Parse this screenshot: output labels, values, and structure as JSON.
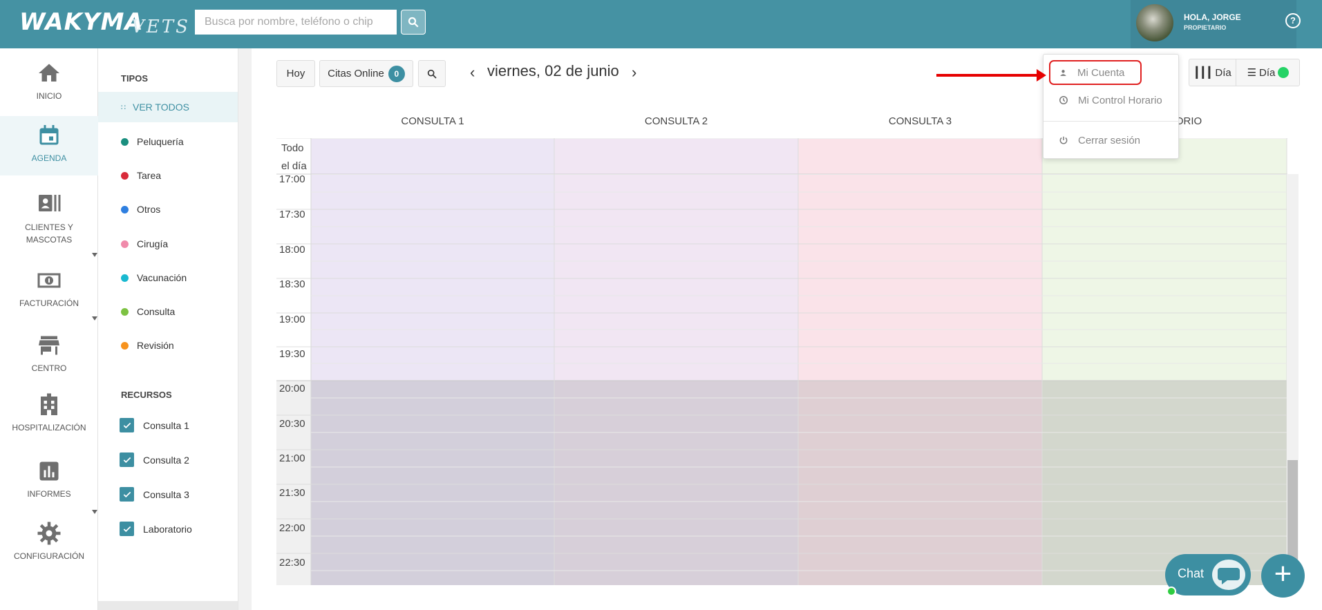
{
  "header": {
    "logo": "WAKYMA",
    "logo_sub": "VETS",
    "search_placeholder": "Busca por nombre, teléfono o chip",
    "greeting": "HOLA, JORGE",
    "role": "PROPIETARIO",
    "help": "?"
  },
  "nav": {
    "items": [
      {
        "label": "INICIO",
        "icon": "home-icon"
      },
      {
        "label": "AGENDA",
        "icon": "calendar-icon"
      },
      {
        "label": "CLIENTES Y MASCOTAS",
        "icon": "contacts-icon"
      },
      {
        "label": "FACTURACIÓN",
        "icon": "money-icon"
      },
      {
        "label": "CENTRO",
        "icon": "store-icon"
      },
      {
        "label": "HOSPITALIZACIÓN",
        "icon": "hospital-icon"
      },
      {
        "label": "INFORMES",
        "icon": "bar-chart-icon"
      },
      {
        "label": "CONFIGURACIÓN",
        "icon": "gear-icon"
      }
    ]
  },
  "types": {
    "title": "TIPOS",
    "all": "VER TODOS",
    "items": [
      {
        "label": "Peluquería",
        "color": "#1a8f7f"
      },
      {
        "label": "Tarea",
        "color": "#d92b3a"
      },
      {
        "label": "Otros",
        "color": "#2f7fe0"
      },
      {
        "label": "Cirugía",
        "color": "#f08aaa"
      },
      {
        "label": "Vacunación",
        "color": "#19b9d0"
      },
      {
        "label": "Consulta",
        "color": "#7dc242"
      },
      {
        "label": "Revisión",
        "color": "#f7931e"
      }
    ]
  },
  "resources": {
    "title": "RECURSOS",
    "items": [
      "Consulta 1",
      "Consulta 2",
      "Consulta 3",
      "Laboratorio"
    ]
  },
  "toolbar": {
    "today": "Hoy",
    "online": "Citas Online",
    "online_count": "0",
    "date": "viernes, 02 de junio",
    "view_day_1": "Día",
    "view_day_2": "Día"
  },
  "calendar": {
    "columns": [
      {
        "label": "CONSULTA 1",
        "color": "#ece6f5"
      },
      {
        "label": "CONSULTA 2",
        "color": "#f1e6f3"
      },
      {
        "label": "CONSULTA 3",
        "color": "#fae3e9"
      },
      {
        "label": "ORIO",
        "color": "#eef6e6"
      }
    ],
    "all_day_line1": "Todo",
    "all_day_line2": "el día",
    "times": [
      "17:00",
      "17:30",
      "18:00",
      "18:30",
      "19:00",
      "19:30",
      "20:00",
      "20:30",
      "21:00",
      "21:30",
      "22:00",
      "22:30"
    ]
  },
  "dropdown": {
    "account": "Mi Cuenta",
    "schedule": "Mi Control Horario",
    "logout": "Cerrar sesión"
  },
  "chat": {
    "label": "Chat"
  },
  "fab": {
    "label": "+"
  }
}
